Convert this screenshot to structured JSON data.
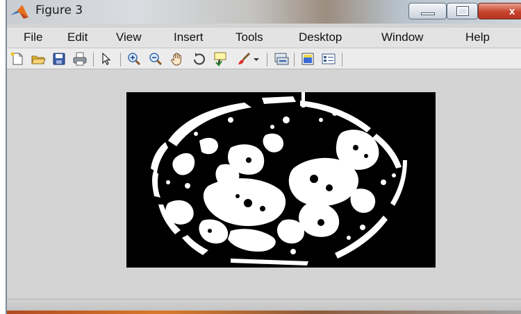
{
  "window": {
    "title": "Figure 3",
    "close_glyph": "x",
    "icons": {
      "app": "matlab-logo-icon",
      "minimize": "minimize-icon",
      "maximize": "maximize-icon",
      "close": "close-icon"
    }
  },
  "menubar": {
    "items": [
      "File",
      "Edit",
      "View",
      "Insert",
      "Tools",
      "Desktop",
      "Window",
      "Help"
    ]
  },
  "toolbar": {
    "tools": [
      "new-figure-icon",
      "open-file-icon",
      "save-icon",
      "print-icon",
      "pointer-icon",
      "zoom-in-icon",
      "zoom-out-icon",
      "pan-hand-icon",
      "rotate-3d-icon",
      "data-cursor-icon",
      "brush-icon",
      "dropdown-arrow-icon",
      "link-plot-icon",
      "colorbar-icon",
      "legend-icon"
    ]
  },
  "figure": {
    "description_color": "#000000",
    "foreground_color": "#ffffff"
  },
  "colors": {
    "background": "#d4d4d4",
    "close_button": "#c8442d"
  }
}
